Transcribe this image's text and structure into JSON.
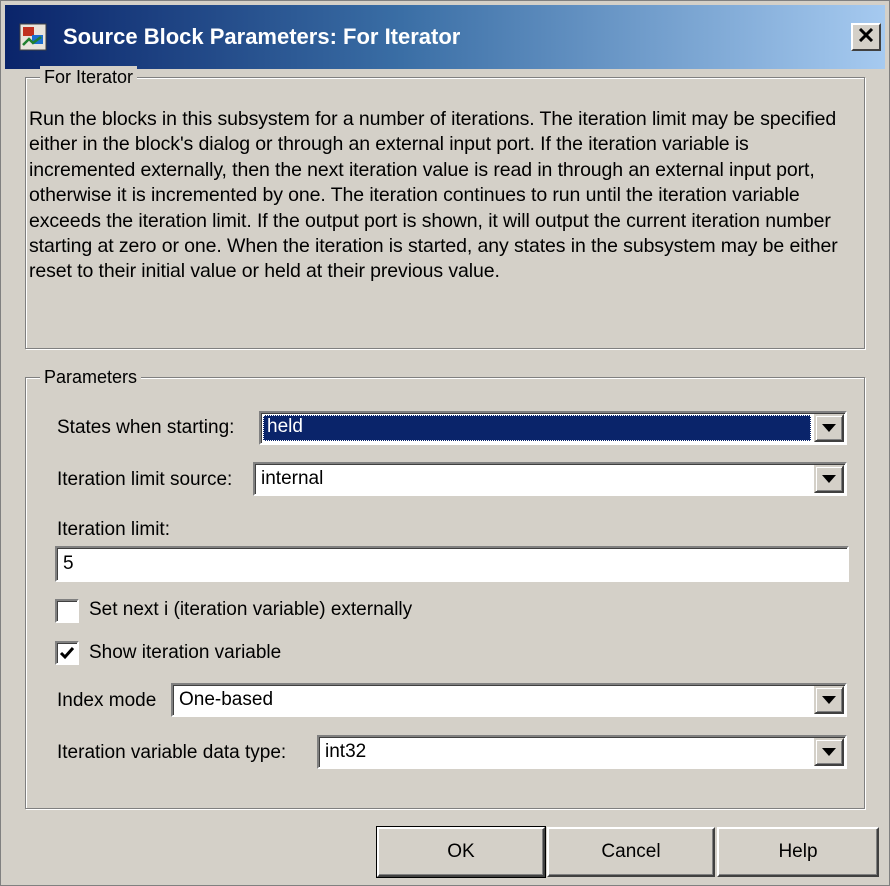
{
  "window": {
    "title": "Source Block Parameters: For Iterator",
    "title_gradient": [
      "#0a246a",
      "#a6caf0"
    ],
    "icon": "simulink-block-icon",
    "close_icon": "close-icon"
  },
  "description_group": {
    "legend": "For Iterator",
    "text": "Run the blocks in this subsystem for a number of iterations.  The iteration limit may be specified either in the block's dialog or through an external input port.  If the iteration variable is incremented externally, then the next iteration value is read in through an external input port, otherwise it is incremented by one.  The iteration continues to run until the iteration variable exceeds the iteration limit.  If the output port is shown, it will output the current iteration number starting at zero or one.  When the iteration is started, any states in the subsystem may be either reset to their initial value or held at their previous value."
  },
  "parameters": {
    "legend": "Parameters",
    "states_when_starting": {
      "label": "States when starting:",
      "value": "held"
    },
    "iteration_limit_source": {
      "label": "Iteration limit source:",
      "value": "internal"
    },
    "iteration_limit": {
      "label": "Iteration limit:",
      "value": "5"
    },
    "set_next_i": {
      "label": "Set next i (iteration variable) externally",
      "checked": false
    },
    "show_iteration_variable": {
      "label": "Show iteration variable",
      "checked": true
    },
    "index_mode": {
      "label": "Index mode",
      "value": "One-based"
    },
    "iteration_variable_data_type": {
      "label": "Iteration variable data type:",
      "value": "int32"
    }
  },
  "buttons": {
    "ok": "OK",
    "cancel": "Cancel",
    "help": "Help"
  },
  "colors": {
    "dialog_background": "#d4d0c8",
    "selection_highlight": "#0a246a"
  }
}
